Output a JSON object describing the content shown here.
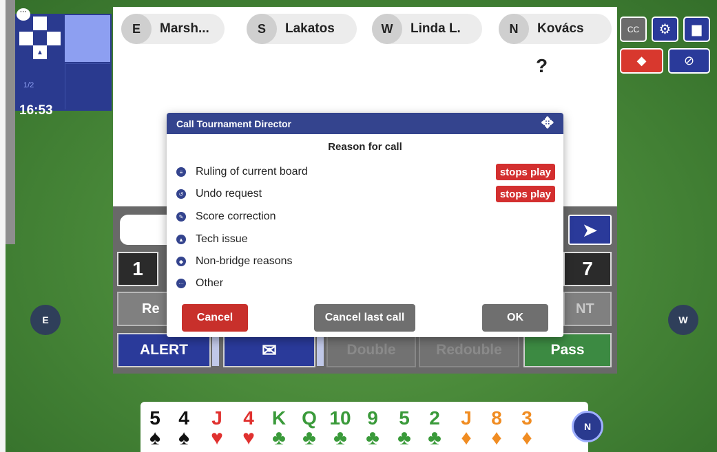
{
  "board": {
    "board_number": "1",
    "fraction": "1/2",
    "time": "16:53",
    "chat_symbol": "···",
    "person_glyph": "▲"
  },
  "players": [
    {
      "dir": "E",
      "name": "Marsh..."
    },
    {
      "dir": "S",
      "name": "Lakatos"
    },
    {
      "dir": "W",
      "name": "Linda L."
    },
    {
      "dir": "N",
      "name": "Kovács"
    }
  ],
  "auction_marker": "?",
  "top_buttons": {
    "cc_label": "CC",
    "gear_icon": "⚙",
    "book_icon": "▆",
    "whistle_icon": "◆",
    "eye_icon": "⊘"
  },
  "bidding": {
    "send_icon": "➤",
    "level_left": "1",
    "level_right": "7",
    "strain_left": "Re",
    "strain_right": "NT",
    "alert_label": "ALERT",
    "mail_icon": "✉",
    "double_label": "Double",
    "redouble_label": "Redouble",
    "pass_label": "Pass"
  },
  "seats": {
    "east": "E",
    "west": "W",
    "north": "N"
  },
  "hand": [
    {
      "rank": "5",
      "suit": "♠",
      "color": "#111111"
    },
    {
      "rank": "4",
      "suit": "♠",
      "color": "#111111"
    },
    {
      "rank": "J",
      "suit": "♥",
      "color": "#e0312f"
    },
    {
      "rank": "4",
      "suit": "♥",
      "color": "#e0312f"
    },
    {
      "rank": "K",
      "suit": "♣",
      "color": "#3a9a3a"
    },
    {
      "rank": "Q",
      "suit": "♣",
      "color": "#3a9a3a"
    },
    {
      "rank": "10",
      "suit": "♣",
      "color": "#3a9a3a"
    },
    {
      "rank": "9",
      "suit": "♣",
      "color": "#3a9a3a"
    },
    {
      "rank": "5",
      "suit": "♣",
      "color": "#3a9a3a"
    },
    {
      "rank": "2",
      "suit": "♣",
      "color": "#3a9a3a"
    },
    {
      "rank": "J",
      "suit": "♦",
      "color": "#f08c22"
    },
    {
      "rank": "8",
      "suit": "♦",
      "color": "#f08c22"
    },
    {
      "rank": "3",
      "suit": "♦",
      "color": "#f08c22"
    }
  ],
  "modal": {
    "title": "Call Tournament Director",
    "move_icon": "✥",
    "subtitle": "Reason for call",
    "reasons": [
      {
        "label": "Ruling of current board",
        "icon": "≡",
        "stops": "stops play"
      },
      {
        "label": "Undo request",
        "icon": "↺",
        "stops": "stops play"
      },
      {
        "label": "Score correction",
        "icon": "✎",
        "stops": ""
      },
      {
        "label": "Tech issue",
        "icon": "▲",
        "stops": ""
      },
      {
        "label": "Non-bridge reasons",
        "icon": "◆",
        "stops": ""
      },
      {
        "label": "Other",
        "icon": "···",
        "stops": ""
      }
    ],
    "cancel_label": "Cancel",
    "cancel_last_label": "Cancel last call",
    "ok_label": "OK"
  },
  "colors": {
    "accent_blue": "#2a3a9a",
    "danger_red": "#d32f2f",
    "table_green": "#4a8a3a"
  }
}
